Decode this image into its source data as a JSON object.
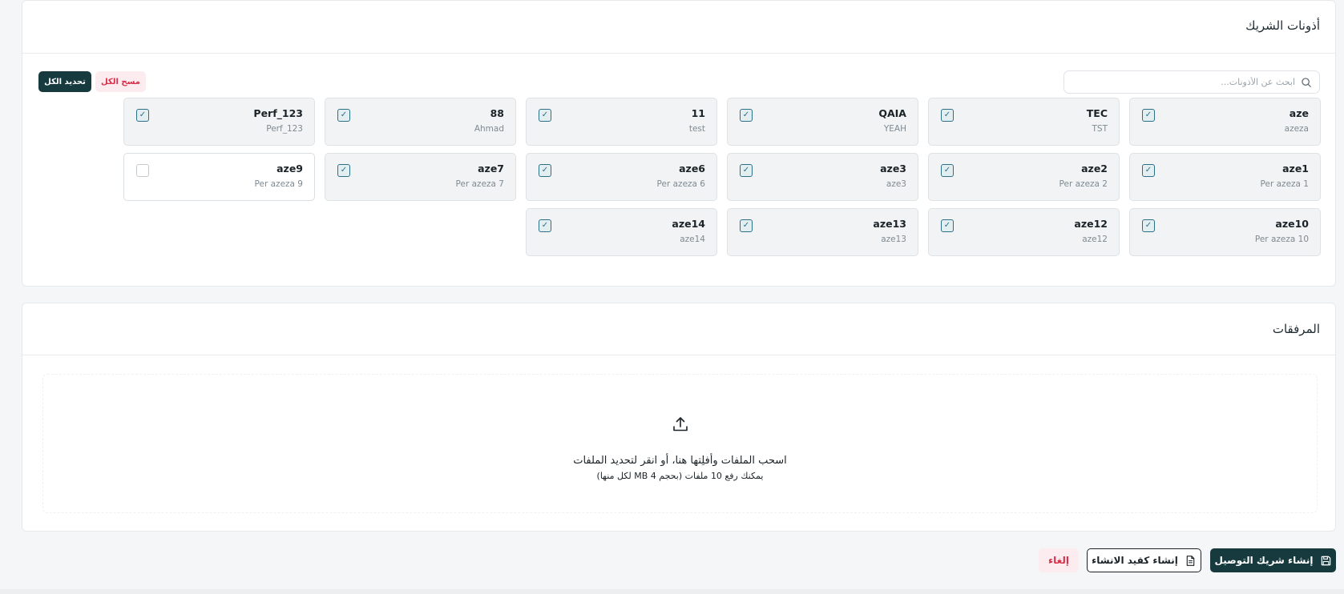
{
  "tokens_section": {
    "title": "أذونات الشريك",
    "search": {
      "placeholder": "ابحث عن الأذونات...",
      "value": ""
    },
    "select_all_label": "تحديد الكل",
    "clear_all_label": "مسح الكل",
    "tokens": [
      {
        "name": "aze",
        "sub": "azeza",
        "checked": true
      },
      {
        "name": "TEC",
        "sub": "TST",
        "checked": true
      },
      {
        "name": "QAIA",
        "sub": "YEAH",
        "checked": true
      },
      {
        "name": "11",
        "sub": "test",
        "checked": true
      },
      {
        "name": "88",
        "sub": "Ahmad",
        "checked": true
      },
      {
        "name": "Perf_123",
        "sub": "Perf_123",
        "checked": true
      },
      {
        "name": "aze1",
        "sub": "Per azeza 1",
        "checked": true
      },
      {
        "name": "aze2",
        "sub": "Per azeza 2",
        "checked": true
      },
      {
        "name": "aze3",
        "sub": "aze3",
        "checked": true
      },
      {
        "name": "aze6",
        "sub": "Per azeza 6",
        "checked": true
      },
      {
        "name": "aze7",
        "sub": "Per azeza 7",
        "checked": true
      },
      {
        "name": "aze9",
        "sub": "Per azeza 9",
        "checked": false
      },
      {
        "name": "aze10",
        "sub": "Per azeza 10",
        "checked": true
      },
      {
        "name": "aze12",
        "sub": "aze12",
        "checked": true
      },
      {
        "name": "aze13",
        "sub": "aze13",
        "checked": true
      },
      {
        "name": "aze14",
        "sub": "aze14",
        "checked": true
      }
    ]
  },
  "attachments_section": {
    "title": "المرفقات",
    "dropzone_title": "اسحب الملفات وأفلِتها هنا، أو انقر لتحديد الملفات",
    "dropzone_hint": "يمكنك رفع 10 ملفات (بحجم 4 MB لكل منها)"
  },
  "actions": {
    "create_label": "إنشاء شريك التوصيل",
    "draft_label": "إنشاء كقيد الانشاء",
    "cancel_label": "إلغاء"
  },
  "icons": {
    "search": "search-icon",
    "upload": "upload-icon",
    "save": "save-icon",
    "document": "document-icon",
    "check": "✓"
  },
  "colors": {
    "primary": "#173a3e",
    "danger": "#d6304a",
    "danger_bg": "#fdecef",
    "checkbox": "#2d6f86"
  }
}
